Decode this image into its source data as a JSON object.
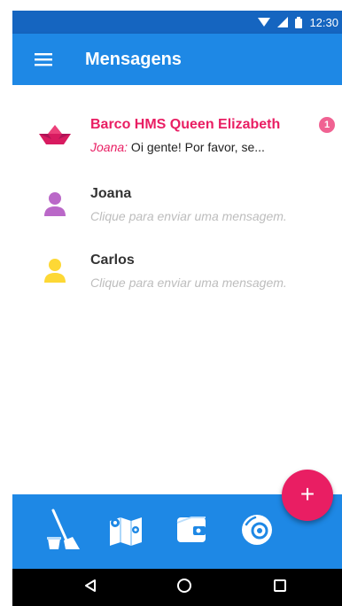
{
  "status_bar": {
    "time": "12:30"
  },
  "app_bar": {
    "title": "Mensagens",
    "menu_icon": "menu-icon"
  },
  "chats": [
    {
      "name": "Barco HMS Queen Elizabeth",
      "sender": "Joana:",
      "preview": " Oi gente! Por favor, se...",
      "unread": "1",
      "avatar_icon": "paper-boat-icon",
      "highlight": true
    },
    {
      "name": "Joana",
      "preview": "Clique para enviar uma mensagem.",
      "avatar_icon": "person-icon",
      "avatar_color": "#ba68c8"
    },
    {
      "name": "Carlos",
      "preview": "Clique para enviar uma mensagem.",
      "avatar_icon": "person-icon",
      "avatar_color": "#fdd835"
    }
  ],
  "fab": {
    "label": "+",
    "icon": "add-icon"
  },
  "bottom_tabs": [
    {
      "icon": "broom-bucket-icon"
    },
    {
      "icon": "map-icon"
    },
    {
      "icon": "wallet-icon"
    },
    {
      "icon": "disc-icon"
    }
  ],
  "nav_bar": {
    "icons": [
      "back-icon",
      "home-icon",
      "recents-icon"
    ]
  },
  "colors": {
    "primary": "#1e88e5",
    "primary_dark": "#1565c0",
    "accent": "#e91e63",
    "badge": "#f06292"
  }
}
